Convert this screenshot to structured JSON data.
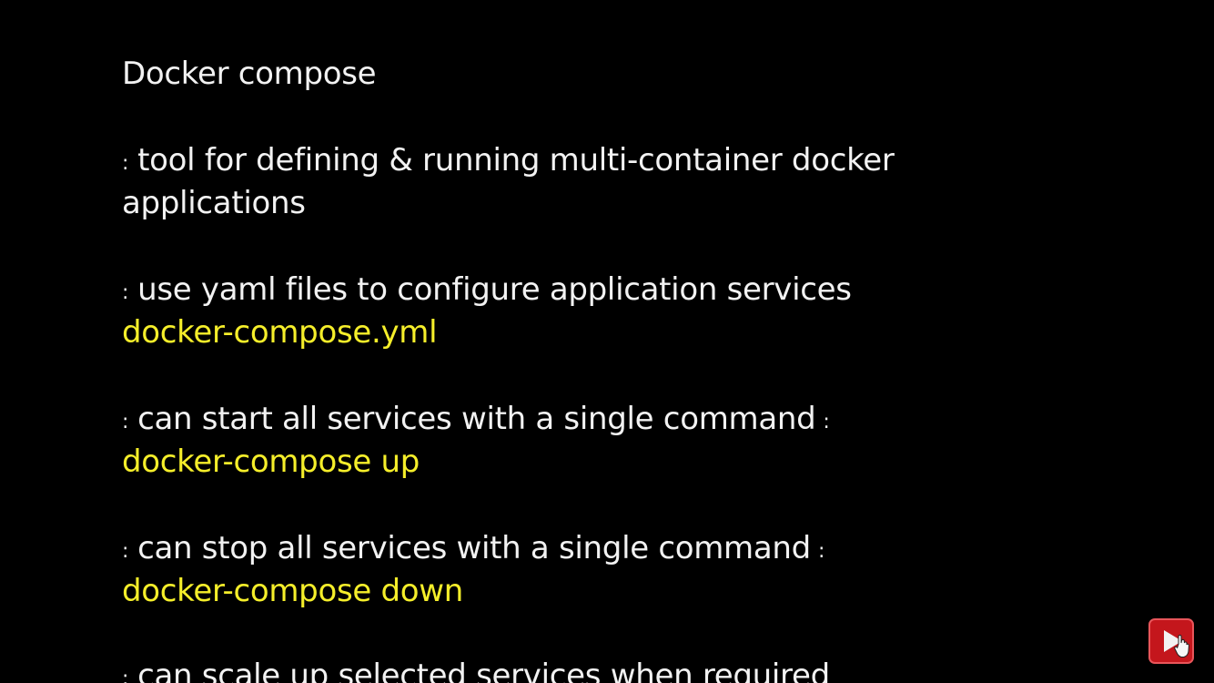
{
  "slide": {
    "title": "Docker compose",
    "bullet_marker": ":",
    "points": [
      {
        "text": "tool for defining & running multi-container docker",
        "continuation": "applications"
      },
      {
        "text": "use yaml files to configure application services",
        "code": "docker-compose.yml"
      },
      {
        "text": "can start all services with a single command",
        "trailing": ":",
        "code": "docker-compose up"
      },
      {
        "text": "can stop all services with a single command",
        "trailing": ":",
        "code": "docker-compose down"
      },
      {
        "text": "can scale up selected services when required"
      }
    ]
  },
  "colors": {
    "background": "#000000",
    "text": "#f2f2f2",
    "highlight": "#f5ee2a",
    "play_button": "#c4161c"
  },
  "overlay": {
    "play_icon": "play-icon",
    "cursor_icon": "hand-cursor-icon"
  }
}
